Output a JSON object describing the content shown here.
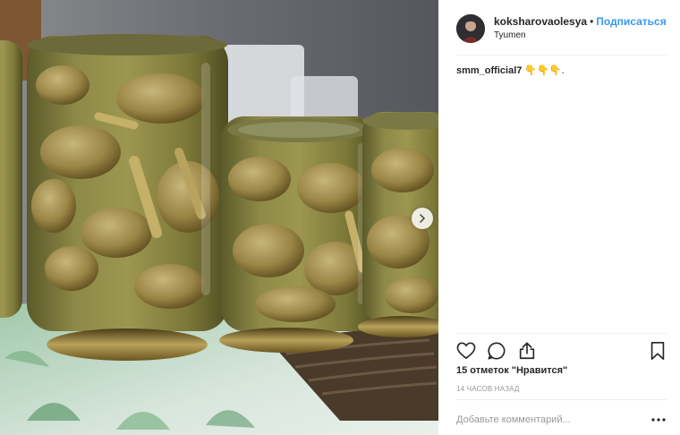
{
  "post": {
    "username": "koksharovaolesya",
    "separator": "•",
    "follow_label": "Подписаться",
    "location": "Tyumen",
    "caption_user": "smm_official7",
    "caption_text": " 👇👇👇."
  },
  "image": {
    "subject": "jars-of-pickled-mushrooms",
    "carousel_next_icon": "chevron-right-icon"
  },
  "actions": {
    "like_icon": "heart-icon",
    "comment_icon": "comment-bubble-icon",
    "share_icon": "share-icon",
    "save_icon": "bookmark-icon"
  },
  "stats": {
    "likes_text": "15 отметок \"Нравится\"",
    "time_text": "14 ЧАСОВ НАЗАД"
  },
  "comment": {
    "placeholder": "Добавьте комментарий...",
    "more_icon": "ellipsis-icon"
  },
  "colors": {
    "link_blue": "#3897f0",
    "muted": "#999999",
    "text": "#262626",
    "divider": "#efefef"
  }
}
